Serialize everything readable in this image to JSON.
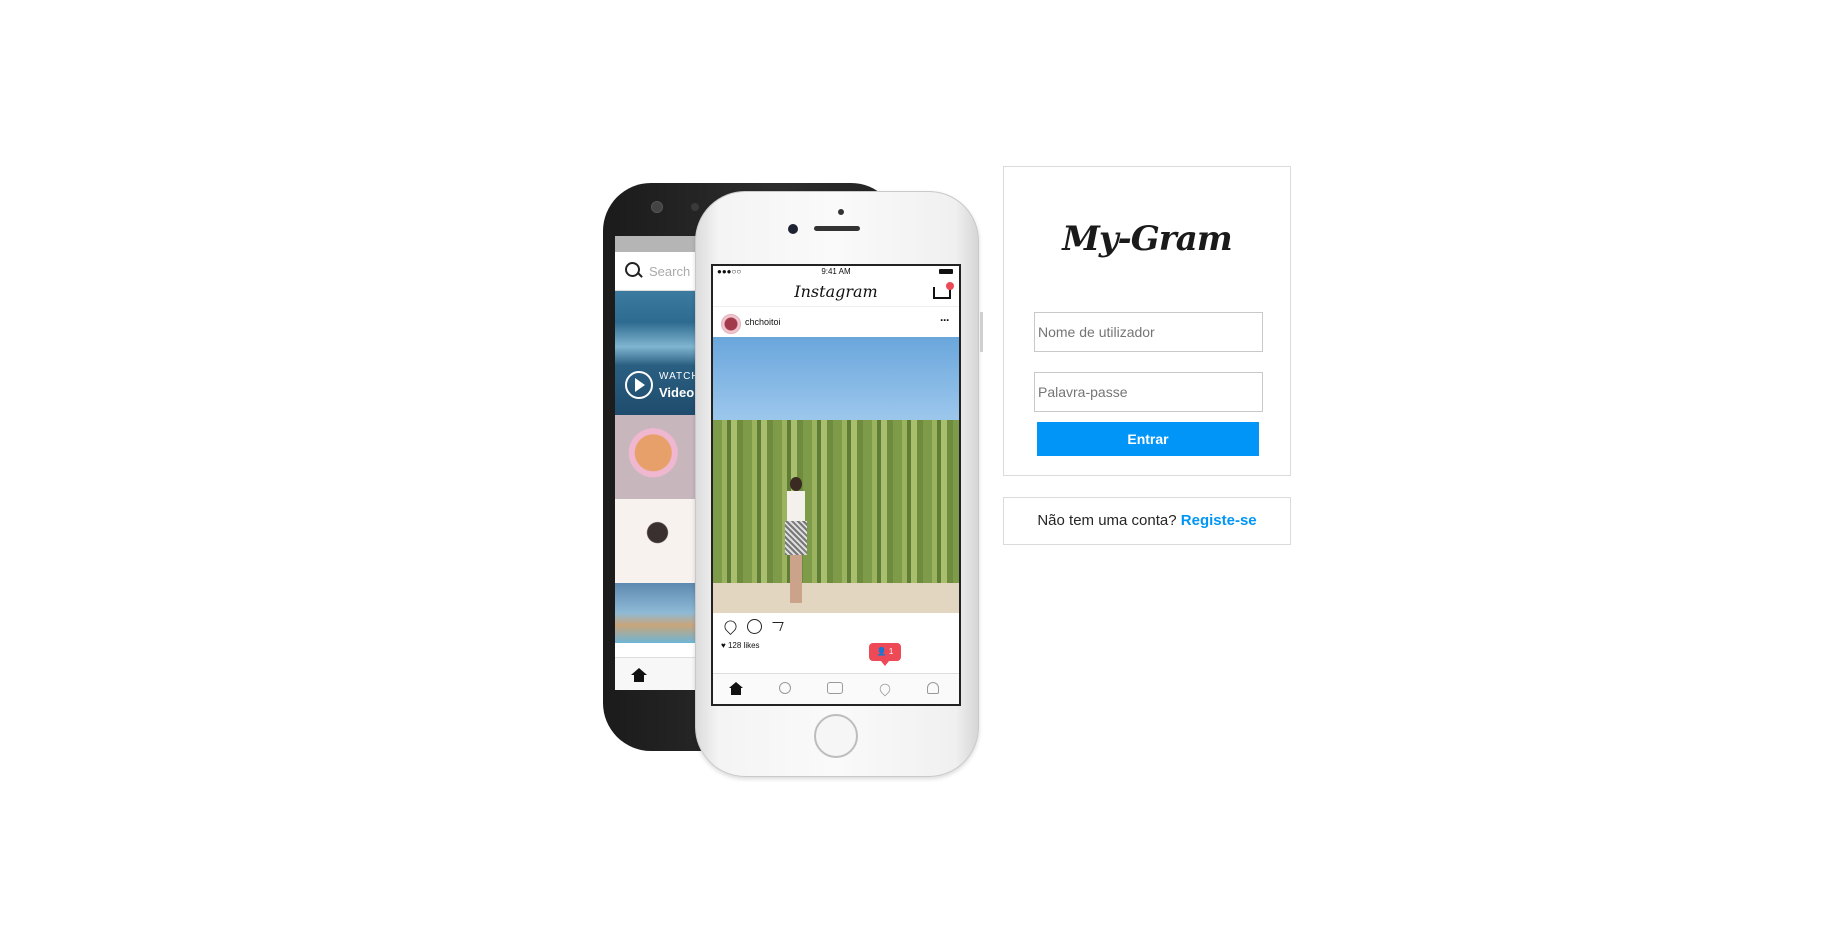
{
  "back_phone": {
    "search_placeholder": "Search",
    "watch_label": "WATCH",
    "video_label": "Video"
  },
  "front_phone": {
    "status_time": "9:41 AM",
    "status_signal": "●●●○○",
    "app_name": "Instagram",
    "post_user": "chchoitoi",
    "more_label": "···",
    "likes": "♥ 128 likes",
    "notification_count": "1",
    "notification_label": "👤 1"
  },
  "login": {
    "logo": "My-Gram",
    "username_placeholder": "Nome de utilizador",
    "password_placeholder": "Palavra-passe",
    "submit_label": "Entrar"
  },
  "signup": {
    "prompt": "Não tem uma conta?",
    "link_label": "Registe-se"
  },
  "colors": {
    "accent": "#0095f6",
    "border": "#dbdbdb",
    "notification": "#ed4956"
  }
}
